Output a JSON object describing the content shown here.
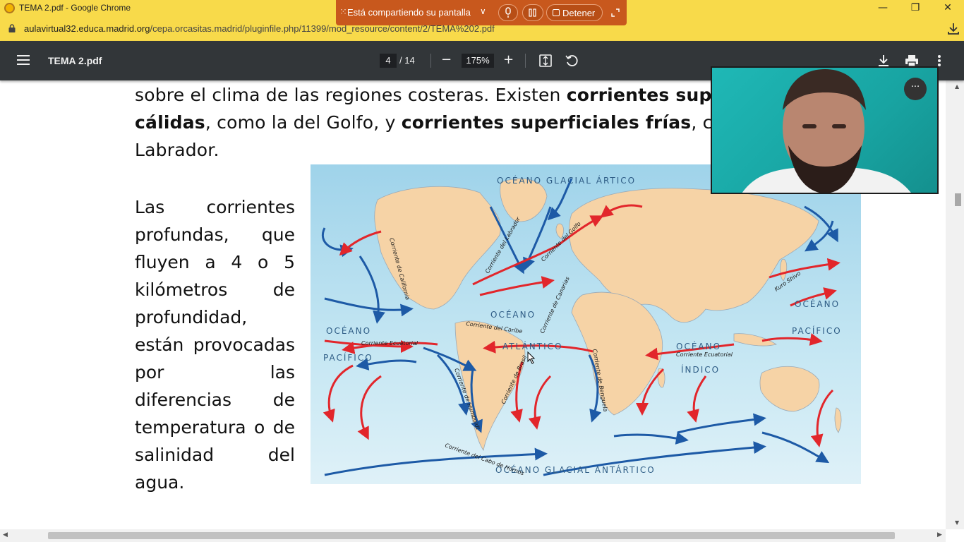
{
  "window": {
    "title": "TEMA 2.pdf - Google Chrome",
    "minimize": "—",
    "restore": "❐",
    "close": "✕"
  },
  "sharing": {
    "grip": "⁙",
    "text": "Está compartiendo su pantalla",
    "chevron": "∨",
    "stop_label": "Detener"
  },
  "address": {
    "host": "aulavirtual32.educa.madrid.org",
    "path": "/cepa.orcasitas.madrid/pluginfile.php/11399/mod_resource/content/2/TEMA%202.pdf"
  },
  "pdf_toolbar": {
    "title": "TEMA 2.pdf",
    "current_page": "4",
    "total_pages": "/ 14",
    "zoom": "175%",
    "zoom_out": "−",
    "zoom_in": "+",
    "fit_icon": "⬚",
    "rotate_icon": "⟲",
    "download_icon": "⤓",
    "print_icon": "⎙",
    "more_icon": "⋮"
  },
  "document": {
    "line1_regular": "sobre el clima de las regiones costeras. Existen ",
    "line1_bold": "corrientes sup",
    "line2_bold_a": "cálidas",
    "line2_regular_a": ", como la del Golfo, y ",
    "line2_bold_b": "corrientes superficiales frías",
    "line2_regular_b": ", c",
    "line3": "Labrador.",
    "left_column": [
      "Las corrientes",
      "profundas, que",
      "fluyen a 4 o 5",
      "kilómetros de",
      "profundidad,",
      "están provocadas",
      "por las",
      "diferencias de",
      "temperatura o de",
      "salinidad del",
      "agua."
    ]
  },
  "map": {
    "ocean_labels": {
      "arctic": "OCÉANO GLACIAL ÁRTICO",
      "atlantic_1": "OCÉANO",
      "atlantic_2": "ATLÁNTICO",
      "pacific_w_1": "OCÉANO",
      "pacific_w_2": "PACÍFICO",
      "pacific_e_1": "OCÉANO",
      "pacific_e_2": "PACÍFICO",
      "indian_1": "OCÉANO",
      "indian_2": "ÍNDICO",
      "antarctic": "OCÉANO GLACIAL ANTÁRTICO"
    },
    "current_labels": {
      "california": "Corriente de California",
      "labrador": "Corriente del Labrador",
      "golfo": "Corriente del Golfo",
      "canarias": "Corriente de Canarias",
      "caribe": "Corriente del Caribe",
      "ecuatorial_w": "Corriente Ecuatorial",
      "ecuatorial_e": "Corriente Ecuatorial",
      "humboldt": "Corriente de Humboldt",
      "brasil": "Corriente de Brasil",
      "benguela": "Corriente de Benguela",
      "kuro_shivo": "Kuro Shivo",
      "cabo_hornos": "Corriente del Cabo de Hornos"
    },
    "colors": {
      "ocean": "#bfe3f1",
      "land": "#f6d3a6",
      "warm_current": "#e2262b",
      "cold_current": "#1d5aa6"
    }
  },
  "webcam": {
    "more_label": "···"
  }
}
